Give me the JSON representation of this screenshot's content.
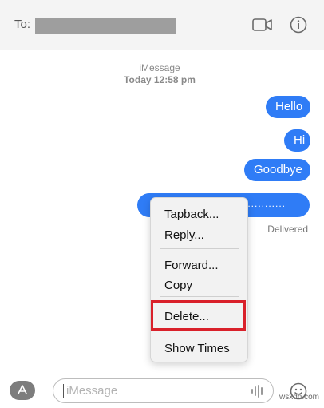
{
  "header": {
    "to_label": "To:",
    "video_icon": "video-camera-icon",
    "info_icon": "info-icon"
  },
  "thread": {
    "service": "iMessage",
    "timestamp": "Today 12:58 pm",
    "messages": [
      {
        "text": "Hello"
      },
      {
        "text": "Hi"
      },
      {
        "text": "Goodbye"
      },
      {
        "text": ".............."
      }
    ],
    "status": "Delivered"
  },
  "context_menu": {
    "items": [
      "Tapback...",
      "Reply...",
      "Forward...",
      "Copy",
      "Delete...",
      "Show Times"
    ],
    "highlighted": "Delete..."
  },
  "composer": {
    "placeholder": "iMessage",
    "apps_icon": "app-store-icon",
    "audio_icon": "audio-waveform-icon",
    "emoji_icon": "emoji-icon"
  },
  "watermark": "wsxdn.com",
  "colors": {
    "bubble": "#2f7cf6",
    "highlight_border": "#d9202a"
  }
}
